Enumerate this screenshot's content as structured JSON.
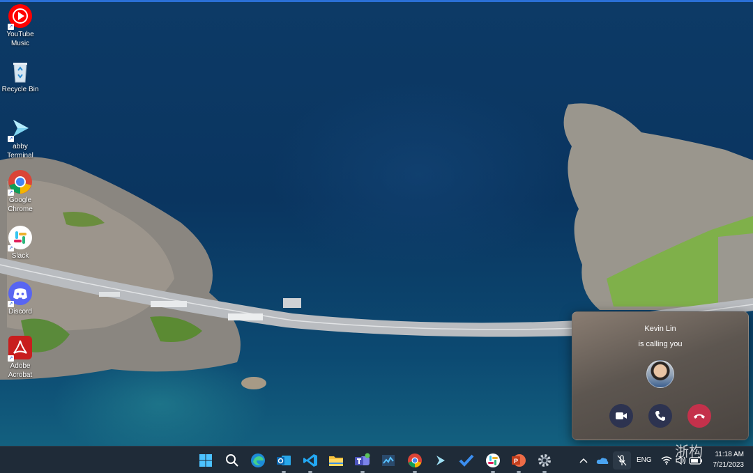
{
  "desktop": {
    "icons": [
      {
        "label": "YouTube\nMusic",
        "icon": "youtube-music-icon"
      },
      {
        "label": "Recycle Bin",
        "icon": "recycle-bin-icon"
      },
      {
        "label": "abby Terminal",
        "icon": "terminal-icon"
      },
      {
        "label": "Google Chrome",
        "icon": "chrome-icon"
      },
      {
        "label": "Slack",
        "icon": "slack-icon"
      },
      {
        "label": "Discord",
        "icon": "discord-icon"
      },
      {
        "label": "Adobe Acrobat",
        "icon": "acrobat-icon"
      }
    ]
  },
  "call": {
    "caller": "Kevin Lin",
    "status": "is calling you",
    "video_label": "video-call",
    "audio_label": "audio-call",
    "decline_label": "decline"
  },
  "taskbar": {
    "apps": [
      "start-icon",
      "search-icon",
      "edge-icon",
      "outlook-icon",
      "vscode-icon",
      "file-explorer-icon",
      "teams-icon",
      "task-manager-icon",
      "chrome-icon",
      "terminal-icon",
      "todo-icon",
      "slack-icon",
      "powerpoint-icon",
      "settings-icon"
    ],
    "tray": {
      "language": "ENG",
      "time": "11:18 AM",
      "date": "7/21/2023"
    }
  },
  "watermark": "浙构",
  "colors": {
    "taskbar_bg": "#1f2b38",
    "decline_red": "#c4314b",
    "call_btn": "#2d3350",
    "accent_blue": "#2a6fd6"
  }
}
